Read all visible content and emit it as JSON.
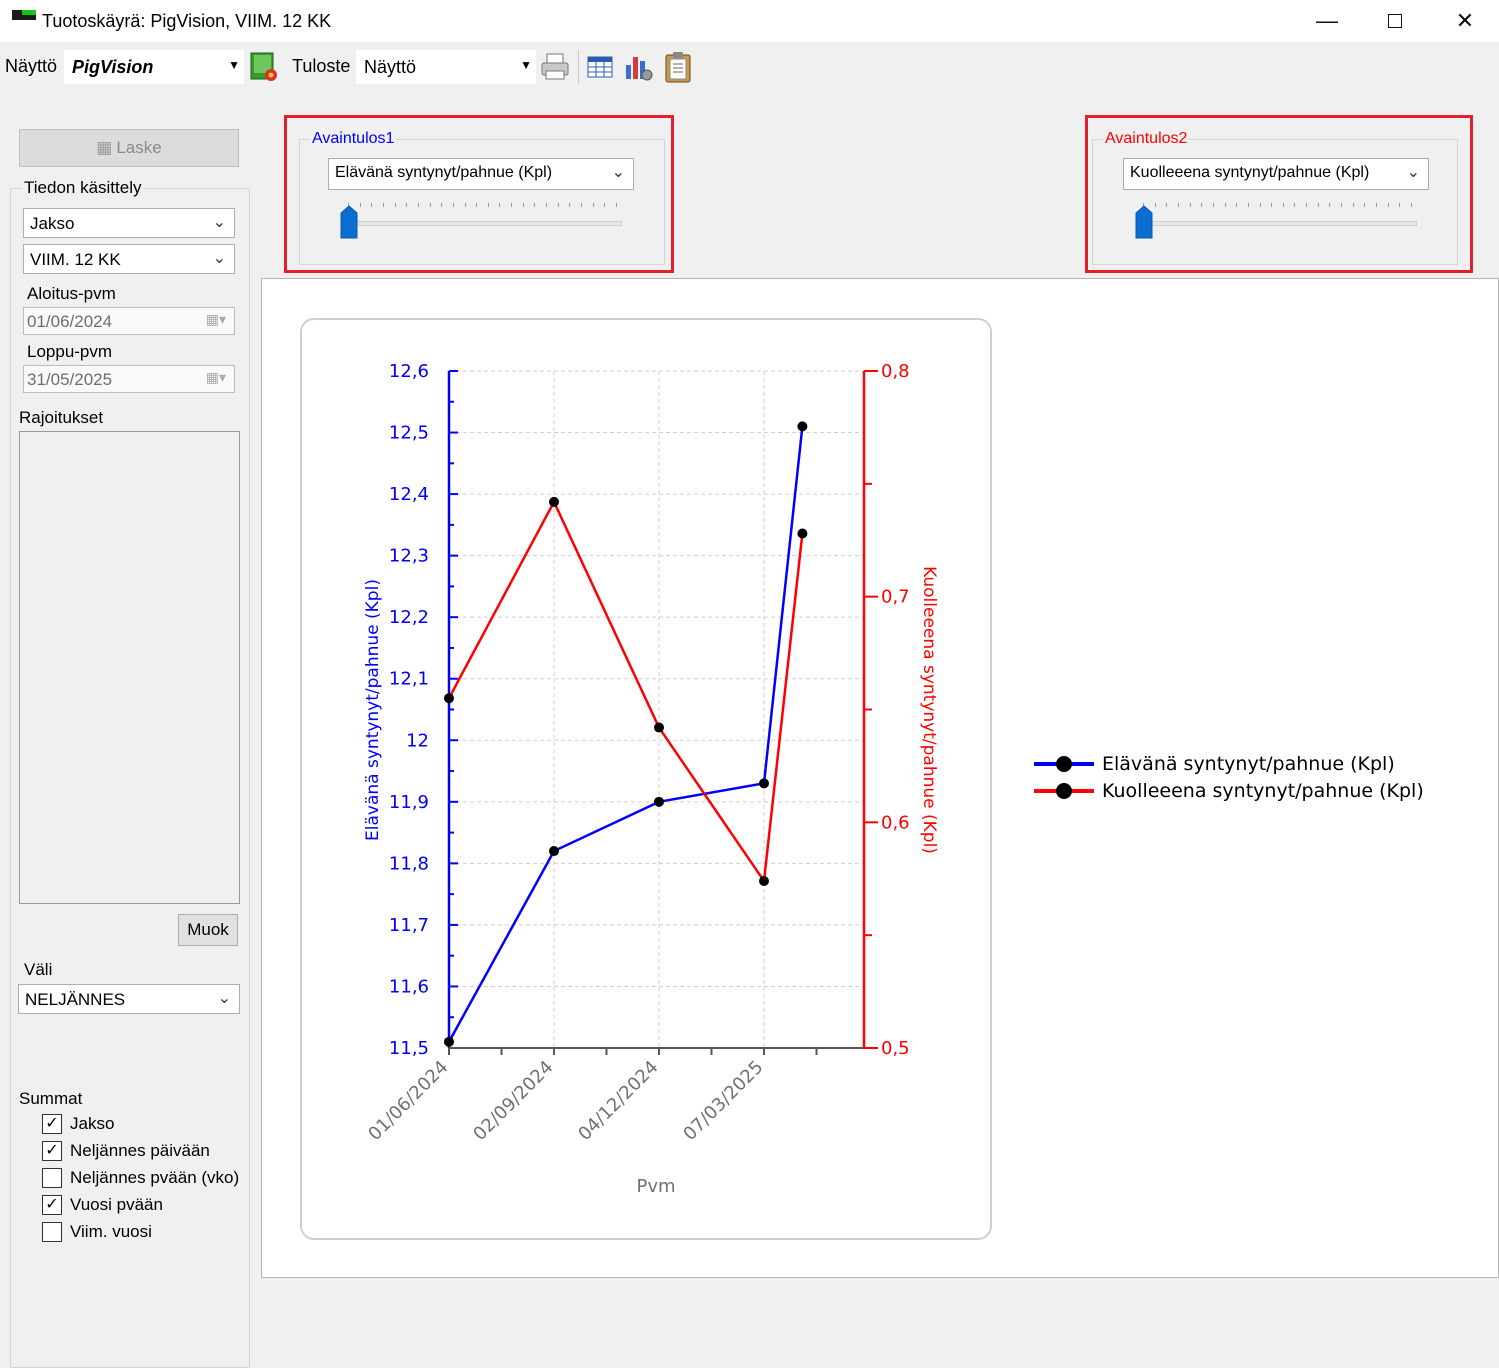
{
  "window": {
    "title": "Tuotoskäyrä: PigVision, VIIM. 12 KK"
  },
  "toolbar": {
    "display_label": "Näyttö",
    "display_value": "PigVision",
    "output_label": "Tuloste",
    "output_value": "Näyttö"
  },
  "sidebar": {
    "calculate_button": "Laske",
    "data_handling_label": "Tiedon käsittely",
    "period_select": "Jakso",
    "range_select": "VIIM. 12 KK",
    "start_label": "Aloitus-pvm",
    "start_date": "01/06/2024",
    "end_label": "Loppu-pvm",
    "end_date": "31/05/2025",
    "restrictions_label": "Rajoitukset",
    "edit_button": "Muok",
    "interval_label": "Väli",
    "interval_select": "NELJÄNNES",
    "totals_label": "Summat",
    "totals": [
      {
        "label": "Jakso",
        "checked": true
      },
      {
        "label": "Neljännes päivään",
        "checked": true
      },
      {
        "label": "Neljännes pvään (vko)",
        "checked": false
      },
      {
        "label": "Vuosi pvään",
        "checked": true
      },
      {
        "label": "Viim. vuosi",
        "checked": false
      }
    ]
  },
  "key1": {
    "title": "Avaintulos1",
    "select": "Elävänä syntynyt/pahnue (Kpl)",
    "slider_position": 0,
    "color": "#0000ff"
  },
  "key2": {
    "title": "Avaintulos2",
    "select": "Kuolleeena syntynyt/pahnue (Kpl)",
    "slider_position": 0,
    "color": "#ff0000"
  },
  "chart_data": {
    "type": "line",
    "xlabel": "Pvm",
    "x_tick_labels": [
      "01/06/2024",
      "02/09/2024",
      "04/12/2024",
      "07/03/2025"
    ],
    "grid": true,
    "legend_position": "right",
    "y_left": {
      "label": "Elävänä syntynyt/pahnue (Kpl)",
      "range": [
        11.5,
        12.6
      ],
      "ticks": [
        "11,5",
        "11,6",
        "11,7",
        "11,8",
        "11,9",
        "12",
        "12,1",
        "12,2",
        "12,3",
        "12,4",
        "12,5",
        "12,6"
      ],
      "color": "#0000ff"
    },
    "y_right": {
      "label": "Kuolleeena syntynyt/pahnue (Kpl)",
      "range": [
        0.5,
        0.8
      ],
      "ticks": [
        "0,5",
        "0,6",
        "0,7",
        "0,8"
      ],
      "color": "#ff0000"
    },
    "series": [
      {
        "name": "Elävänä syntynyt/pahnue (Kpl)",
        "axis": "left",
        "color": "#0000ff",
        "points": [
          {
            "x": "2024-06-01",
            "y": 11.51
          },
          {
            "x": "2024-09-02",
            "y": 11.82
          },
          {
            "x": "2024-12-04",
            "y": 11.9
          },
          {
            "x": "2025-03-07",
            "y": 11.93
          },
          {
            "x": "2025-04-10",
            "y": 12.51
          }
        ]
      },
      {
        "name": "Kuolleeena syntynyt/pahnue (Kpl)",
        "axis": "right",
        "color": "#ff0000",
        "points": [
          {
            "x": "2024-06-01",
            "y": 0.655
          },
          {
            "x": "2024-09-02",
            "y": 0.742
          },
          {
            "x": "2024-12-04",
            "y": 0.642
          },
          {
            "x": "2025-03-07",
            "y": 0.574
          },
          {
            "x": "2025-04-10",
            "y": 0.728
          }
        ]
      }
    ]
  }
}
